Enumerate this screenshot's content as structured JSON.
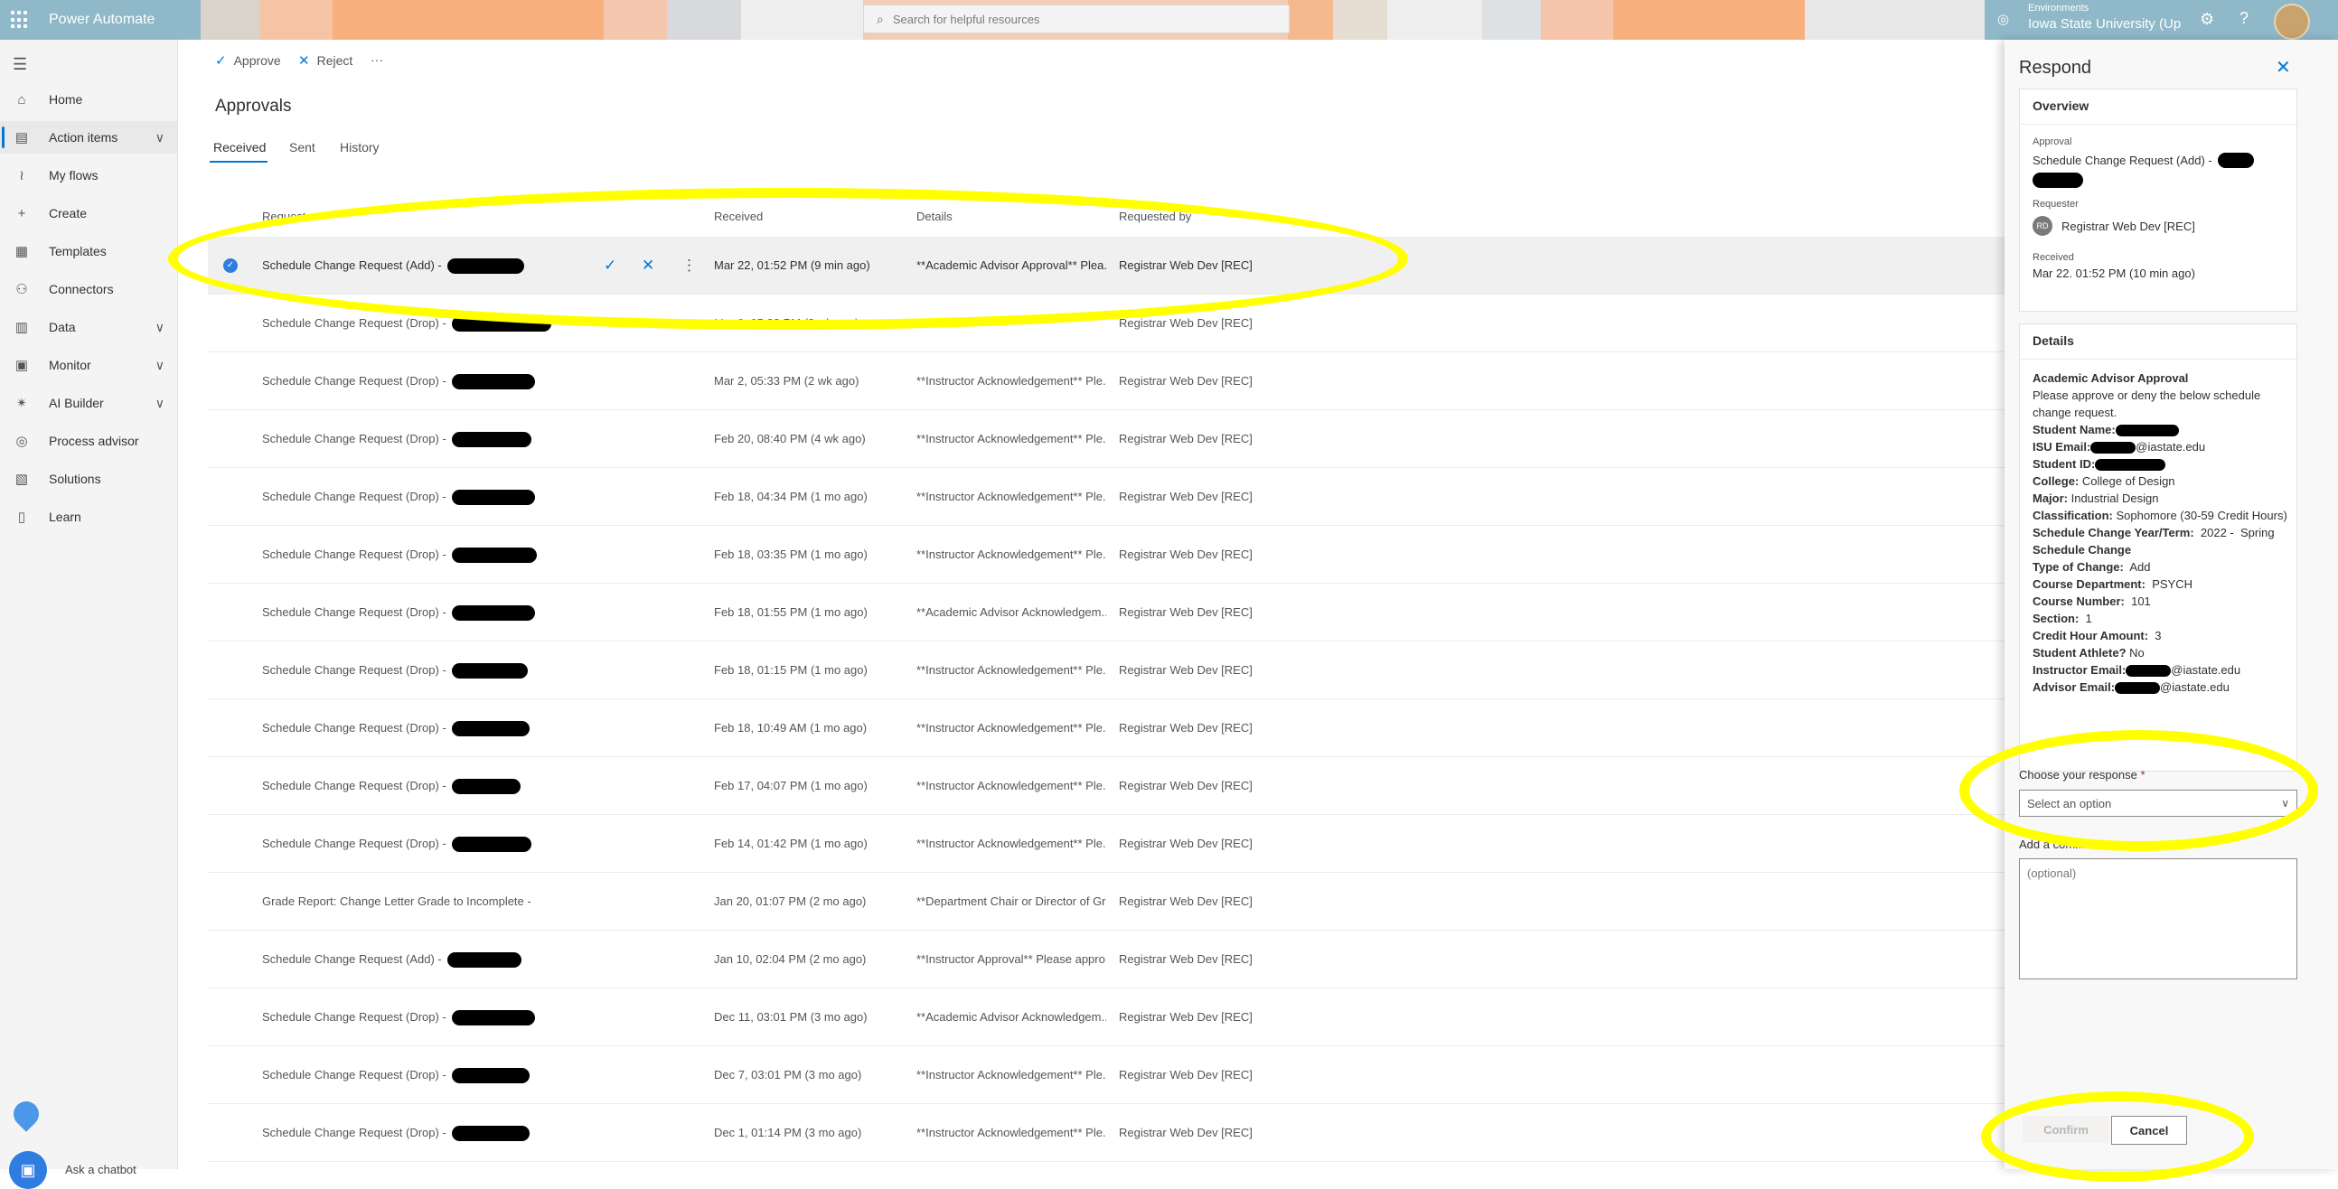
{
  "app": {
    "name": "Power Automate"
  },
  "search": {
    "placeholder": "Search for helpful resources"
  },
  "environment": {
    "label": "Environments",
    "value": "Iowa State University (Up"
  },
  "nav": {
    "items": [
      {
        "label": "Home",
        "icon": "home-icon"
      },
      {
        "label": "Action items",
        "icon": "clipboard-icon",
        "expandable": true,
        "active": true
      },
      {
        "label": "My flows",
        "icon": "flow-icon"
      },
      {
        "label": "Create",
        "icon": "plus-icon"
      },
      {
        "label": "Templates",
        "icon": "templates-icon"
      },
      {
        "label": "Connectors",
        "icon": "connector-icon"
      },
      {
        "label": "Data",
        "icon": "database-icon",
        "expandable": true
      },
      {
        "label": "Monitor",
        "icon": "monitor-icon",
        "expandable": true
      },
      {
        "label": "AI Builder",
        "icon": "ai-builder-icon",
        "expandable": true
      },
      {
        "label": "Process advisor",
        "icon": "process-advisor-icon"
      },
      {
        "label": "Solutions",
        "icon": "solutions-icon"
      },
      {
        "label": "Learn",
        "icon": "book-icon"
      }
    ],
    "chatbot": "Ask a chatbot"
  },
  "toolbar": {
    "approve": "Approve",
    "reject": "Reject",
    "more": "···"
  },
  "page": {
    "title": "Approvals",
    "tabs": [
      "Received",
      "Sent",
      "History"
    ],
    "active_tab": "Received"
  },
  "table": {
    "columns": [
      "Request",
      "Received",
      "Details",
      "Requested by"
    ],
    "rows": [
      {
        "request": "Schedule Change Request (Add) -",
        "received": "Mar 22, 01:52 PM (9 min ago)",
        "details": "**Academic Advisor Approval** Plea...",
        "by": "Registrar Web Dev [REC]",
        "selected": true
      },
      {
        "request": "Schedule Change Request (Drop) -",
        "received": "Mar 2, 05:33 PM (2 wk ago)",
        "details": "",
        "by": "Registrar Web Dev [REC]"
      },
      {
        "request": "Schedule Change Request (Drop) -",
        "received": "Mar 2, 05:33 PM (2 wk ago)",
        "details": "**Instructor Acknowledgement** Ple...",
        "by": "Registrar Web Dev [REC]"
      },
      {
        "request": "Schedule Change Request (Drop) -",
        "received": "Feb 20, 08:40 PM (4 wk ago)",
        "details": "**Instructor Acknowledgement** Ple...",
        "by": "Registrar Web Dev [REC]"
      },
      {
        "request": "Schedule Change Request (Drop) -",
        "received": "Feb 18, 04:34 PM (1 mo ago)",
        "details": "**Instructor Acknowledgement** Ple...",
        "by": "Registrar Web Dev [REC]"
      },
      {
        "request": "Schedule Change Request (Drop) -",
        "received": "Feb 18, 03:35 PM (1 mo ago)",
        "details": "**Instructor Acknowledgement** Ple...",
        "by": "Registrar Web Dev [REC]"
      },
      {
        "request": "Schedule Change Request (Drop) -",
        "received": "Feb 18, 01:55 PM (1 mo ago)",
        "details": "**Academic Advisor Acknowledgem...",
        "by": "Registrar Web Dev [REC]"
      },
      {
        "request": "Schedule Change Request (Drop) -",
        "received": "Feb 18, 01:15 PM (1 mo ago)",
        "details": "**Instructor Acknowledgement** Ple...",
        "by": "Registrar Web Dev [REC]"
      },
      {
        "request": "Schedule Change Request (Drop) -",
        "received": "Feb 18, 10:49 AM (1 mo ago)",
        "details": "**Instructor Acknowledgement** Ple...",
        "by": "Registrar Web Dev [REC]"
      },
      {
        "request": "Schedule Change Request (Drop) -",
        "received": "Feb 17, 04:07 PM (1 mo ago)",
        "details": "**Instructor Acknowledgement** Ple...",
        "by": "Registrar Web Dev [REC]"
      },
      {
        "request": "Schedule Change Request (Drop) -",
        "received": "Feb 14, 01:42 PM (1 mo ago)",
        "details": "**Instructor Acknowledgement** Ple...",
        "by": "Registrar Web Dev [REC]"
      },
      {
        "request": "Grade Report: Change Letter Grade to Incomplete -",
        "received": "Jan 20, 01:07 PM (2 mo ago)",
        "details": "**Department Chair or Director of Gr...",
        "by": "Registrar Web Dev [REC]"
      },
      {
        "request": "Schedule Change Request (Add) -",
        "received": "Jan 10, 02:04 PM (2 mo ago)",
        "details": "**Instructor Approval** Please appro...",
        "by": "Registrar Web Dev [REC]"
      },
      {
        "request": "Schedule Change Request (Drop) -",
        "received": "Dec 11, 03:01 PM (3 mo ago)",
        "details": "**Academic Advisor Acknowledgem...",
        "by": "Registrar Web Dev [REC]"
      },
      {
        "request": "Schedule Change Request (Drop) -",
        "received": "Dec 7, 03:01 PM (3 mo ago)",
        "details": "**Instructor Acknowledgement** Ple...",
        "by": "Registrar Web Dev [REC]"
      },
      {
        "request": "Schedule Change Request (Drop) -",
        "received": "Dec 1, 01:14 PM (3 mo ago)",
        "details": "**Instructor Acknowledgement** Ple...",
        "by": "Registrar Web Dev [REC]"
      }
    ]
  },
  "panel": {
    "title": "Respond",
    "overview": {
      "header": "Overview",
      "approval_label": "Approval",
      "approval_value": "Schedule Change Request (Add) -",
      "requester_label": "Requester",
      "requester_initials": "RD",
      "requester_value": "Registrar Web Dev [REC]",
      "received_label": "Received",
      "received_value": "Mar 22. 01:52 PM (10 min ago)"
    },
    "details": {
      "header": "Details",
      "heading": "Academic Advisor Approval",
      "intro": "Please approve or deny the below schedule change request.",
      "fields": [
        {
          "k": "Student Name:",
          "v": "",
          "redacted": true
        },
        {
          "k": "ISU Email:",
          "v": "@iastate.edu",
          "redacted": true
        },
        {
          "k": "Student ID:",
          "v": "",
          "redacted": true
        },
        {
          "k": "College:",
          "v": " College of Design"
        },
        {
          "k": "Major:",
          "v": " Industrial Design"
        },
        {
          "k": "Classification:",
          "v": " Sophomore (30-59 Credit Hours)"
        },
        {
          "k": "Schedule Change Year/Term:",
          "v": "  2022 -  Spring"
        },
        {
          "k": "Schedule Change",
          "v": ""
        },
        {
          "k": "Type of Change:",
          "v": "  Add"
        },
        {
          "k": "Course Department:",
          "v": "  PSYCH"
        },
        {
          "k": "Course Number:",
          "v": "  101"
        },
        {
          "k": "Section:",
          "v": "  1"
        },
        {
          "k": "Credit Hour Amount:",
          "v": "  3"
        },
        {
          "k": "Student Athlete?",
          "v": " No"
        },
        {
          "k": "Instructor Email:",
          "v": "@iastate.edu",
          "redacted": true
        },
        {
          "k": "Advisor Email:",
          "v": "@iastate.edu",
          "redacted": true
        }
      ]
    },
    "response_label": "Choose your response",
    "required_mark": "*",
    "response_placeholder": "Select an option",
    "comment_label": "Add a comment",
    "comment_placeholder": "(optional)",
    "confirm": "Confirm",
    "cancel": "Cancel"
  },
  "colors": {
    "accent": "#0078d4",
    "highlight": "#ffff00",
    "header_bg": "#8fb8c8"
  }
}
